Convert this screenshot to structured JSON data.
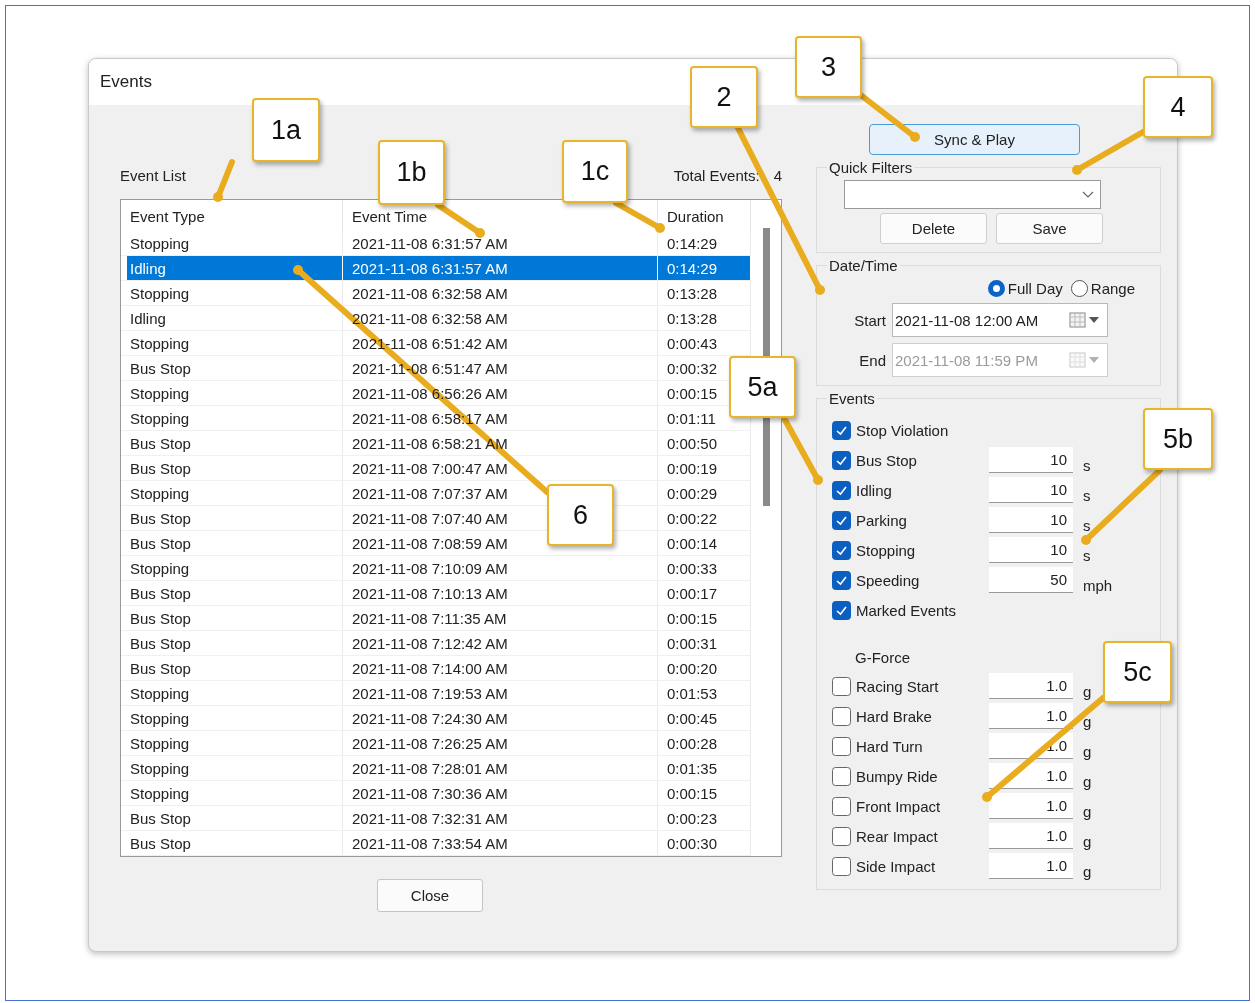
{
  "window": {
    "title": "Events"
  },
  "event_list": {
    "label": "Event List",
    "total_label": "Total Events:",
    "total_count": "4",
    "columns": [
      "Event Type",
      "Event Time",
      "Duration"
    ],
    "rows": [
      {
        "type": "Stopping",
        "time": "2021-11-08 6:31:57 AM",
        "duration": "0:14:29",
        "selected": false
      },
      {
        "type": "Idling",
        "time": "2021-11-08 6:31:57 AM",
        "duration": "0:14:29",
        "selected": true
      },
      {
        "type": "Stopping",
        "time": "2021-11-08 6:32:58 AM",
        "duration": "0:13:28",
        "selected": false
      },
      {
        "type": "Idling",
        "time": "2021-11-08 6:32:58 AM",
        "duration": "0:13:28",
        "selected": false
      },
      {
        "type": "Stopping",
        "time": "2021-11-08 6:51:42 AM",
        "duration": "0:00:43",
        "selected": false
      },
      {
        "type": "Bus Stop",
        "time": "2021-11-08 6:51:47 AM",
        "duration": "0:00:32",
        "selected": false
      },
      {
        "type": "Stopping",
        "time": "2021-11-08 6:56:26 AM",
        "duration": "0:00:15",
        "selected": false
      },
      {
        "type": "Stopping",
        "time": "2021-11-08 6:58:17 AM",
        "duration": "0:01:11",
        "selected": false
      },
      {
        "type": "Bus Stop",
        "time": "2021-11-08 6:58:21 AM",
        "duration": "0:00:50",
        "selected": false
      },
      {
        "type": "Bus Stop",
        "time": "2021-11-08 7:00:47 AM",
        "duration": "0:00:19",
        "selected": false
      },
      {
        "type": "Stopping",
        "time": "2021-11-08 7:07:37 AM",
        "duration": "0:00:29",
        "selected": false
      },
      {
        "type": "Bus Stop",
        "time": "2021-11-08 7:07:40 AM",
        "duration": "0:00:22",
        "selected": false
      },
      {
        "type": "Bus Stop",
        "time": "2021-11-08 7:08:59 AM",
        "duration": "0:00:14",
        "selected": false
      },
      {
        "type": "Stopping",
        "time": "2021-11-08 7:10:09 AM",
        "duration": "0:00:33",
        "selected": false
      },
      {
        "type": "Bus Stop",
        "time": "2021-11-08 7:10:13 AM",
        "duration": "0:00:17",
        "selected": false
      },
      {
        "type": "Bus Stop",
        "time": "2021-11-08 7:11:35 AM",
        "duration": "0:00:15",
        "selected": false
      },
      {
        "type": "Bus Stop",
        "time": "2021-11-08 7:12:42 AM",
        "duration": "0:00:31",
        "selected": false
      },
      {
        "type": "Bus Stop",
        "time": "2021-11-08 7:14:00 AM",
        "duration": "0:00:20",
        "selected": false
      },
      {
        "type": "Stopping",
        "time": "2021-11-08 7:19:53 AM",
        "duration": "0:01:53",
        "selected": false
      },
      {
        "type": "Stopping",
        "time": "2021-11-08 7:24:30 AM",
        "duration": "0:00:45",
        "selected": false
      },
      {
        "type": "Stopping",
        "time": "2021-11-08 7:26:25 AM",
        "duration": "0:00:28",
        "selected": false
      },
      {
        "type": "Stopping",
        "time": "2021-11-08 7:28:01 AM",
        "duration": "0:01:35",
        "selected": false
      },
      {
        "type": "Stopping",
        "time": "2021-11-08 7:30:36 AM",
        "duration": "0:00:15",
        "selected": false
      },
      {
        "type": "Bus Stop",
        "time": "2021-11-08 7:32:31 AM",
        "duration": "0:00:23",
        "selected": false
      },
      {
        "type": "Bus Stop",
        "time": "2021-11-08 7:33:54 AM",
        "duration": "0:00:30",
        "selected": false
      }
    ]
  },
  "close_button": "Close",
  "sync_button": "Sync & Play",
  "quick_filters": {
    "label": "Quick Filters",
    "buttons": [
      "Delete",
      "Save"
    ]
  },
  "date_time": {
    "label": "Date/Time",
    "modes": [
      {
        "label": "Full Day",
        "selected": true
      },
      {
        "label": "Range",
        "selected": false
      }
    ],
    "fields": [
      {
        "label": "Start",
        "value": "2021-11-08 12:00 AM",
        "disabled": false
      },
      {
        "label": "End",
        "value": "2021-11-08 11:59 PM",
        "disabled": true
      }
    ]
  },
  "events": {
    "label": "Events",
    "items": [
      {
        "label": "Stop Violation",
        "checked": true
      },
      {
        "label": "Bus Stop",
        "checked": true,
        "value": "10",
        "unit": "s"
      },
      {
        "label": "Idling",
        "checked": true,
        "value": "10",
        "unit": "s"
      },
      {
        "label": "Parking",
        "checked": true,
        "value": "10",
        "unit": "s"
      },
      {
        "label": "Stopping",
        "checked": true,
        "value": "10",
        "unit": "s"
      },
      {
        "label": "Speeding",
        "checked": true,
        "value": "50",
        "unit": "mph"
      },
      {
        "label": "Marked Events",
        "checked": true
      }
    ],
    "gforce": {
      "label": "G-Force",
      "items": [
        {
          "label": "Racing Start",
          "checked": false,
          "value": "1.0",
          "unit": "g"
        },
        {
          "label": "Hard Brake",
          "checked": false,
          "value": "1.0",
          "unit": "g"
        },
        {
          "label": "Hard Turn",
          "checked": false,
          "value": "1.0",
          "unit": "g"
        },
        {
          "label": "Bumpy Ride",
          "checked": false,
          "value": "1.0",
          "unit": "g"
        },
        {
          "label": "Front Impact",
          "checked": false,
          "value": "1.0",
          "unit": "g"
        },
        {
          "label": "Rear Impact",
          "checked": false,
          "value": "1.0",
          "unit": "g"
        },
        {
          "label": "Side Impact",
          "checked": false,
          "value": "1.0",
          "unit": "g"
        }
      ]
    }
  },
  "callouts": [
    {
      "label": "1a"
    },
    {
      "label": "1b"
    },
    {
      "label": "1c"
    },
    {
      "label": "2"
    },
    {
      "label": "3"
    },
    {
      "label": "4"
    },
    {
      "label": "5a"
    },
    {
      "label": "5b"
    },
    {
      "label": "5c"
    },
    {
      "label": "6"
    }
  ]
}
